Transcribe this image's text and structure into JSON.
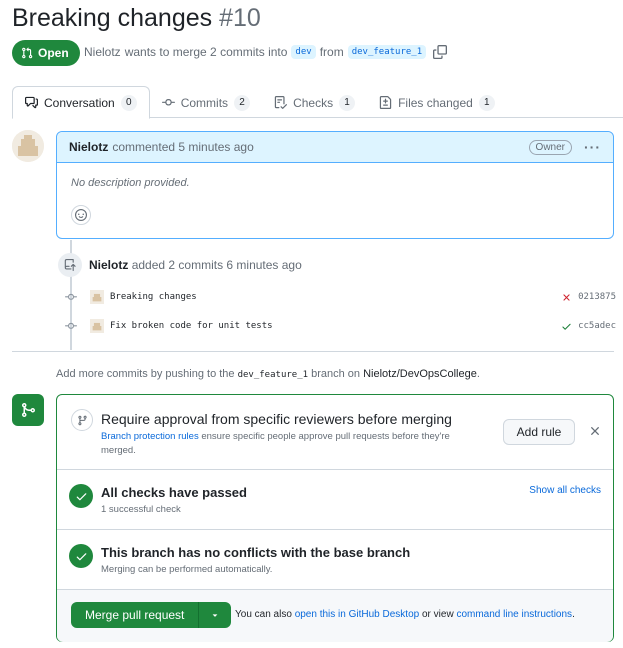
{
  "pr": {
    "title": "Breaking changes",
    "number": "#10",
    "state": "Open",
    "author": "Nielotz",
    "merge_text": "wants to merge 2 commits into",
    "base_branch": "dev",
    "from_text": "from",
    "head_branch": "dev_feature_1"
  },
  "tabs": [
    {
      "label": "Conversation",
      "count": "0",
      "icon": "comment-discussion-icon"
    },
    {
      "label": "Commits",
      "count": "2",
      "icon": "git-commit-icon"
    },
    {
      "label": "Checks",
      "count": "1",
      "icon": "checklist-icon"
    },
    {
      "label": "Files changed",
      "count": "1",
      "icon": "file-diff-icon"
    }
  ],
  "comment": {
    "author": "Nielotz",
    "action": "commented 5 minutes ago",
    "badge": "Owner",
    "body": "No description provided."
  },
  "timeline": {
    "author": "Nielotz",
    "event": "added 2 commits 6 minutes ago",
    "commits": [
      {
        "message": "Breaking changes",
        "sha": "0213875",
        "status": "failure"
      },
      {
        "message": "Fix broken code for unit tests",
        "sha": "cc5adec",
        "status": "success"
      }
    ]
  },
  "push_hint": {
    "prefix": "Add more commits by pushing to the",
    "branch": "dev_feature_1",
    "middle": "branch on",
    "repo": "Nielotz/DevOpsCollege",
    "suffix": "."
  },
  "merge_box": {
    "rule_title": "Require approval from specific reviewers before merging",
    "rule_link": "Branch protection rules",
    "rule_desc": "ensure specific people approve pull requests before they're merged.",
    "add_rule": "Add rule",
    "checks_title": "All checks have passed",
    "checks_sub": "1 successful check",
    "show_all": "Show all checks",
    "conflicts_title": "This branch has no conflicts with the base branch",
    "conflicts_sub": "Merging can be performed automatically.",
    "merge_button": "Merge pull request",
    "alt_prefix": "You can also",
    "alt_desktop": "open this in GitHub Desktop",
    "alt_or": "or view",
    "alt_cli": "command line instructions",
    "alt_suffix": "."
  },
  "colors": {
    "open_green": "#1f883d",
    "link_blue": "#0969da",
    "failure_red": "#cf222e",
    "comment_header_bg": "#ddf4ff"
  }
}
